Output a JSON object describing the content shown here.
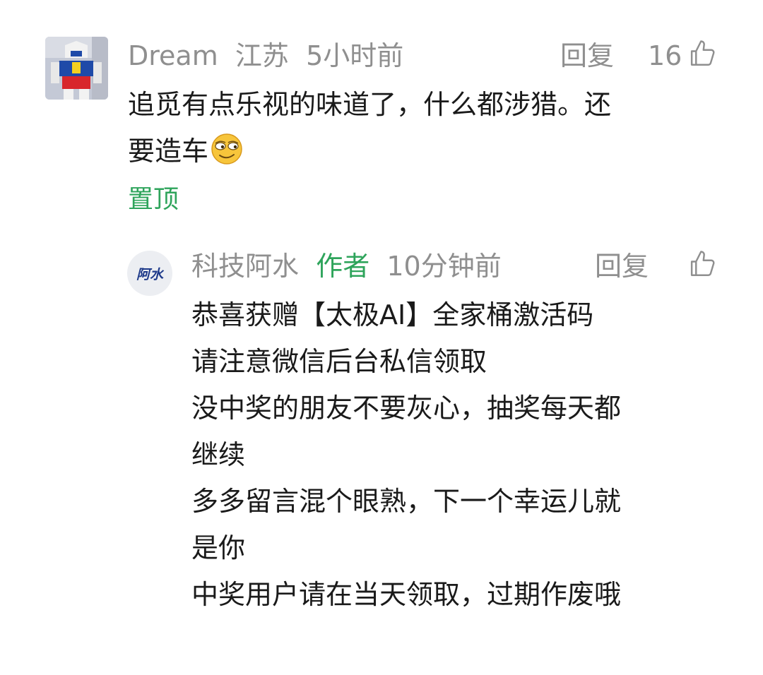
{
  "comment": {
    "user": "Dream",
    "location": "江苏",
    "time": "5小时前",
    "reply_label": "回复",
    "like_count": "16",
    "text_line1": "追觅有点乐视的味道了，什么都涉猎。还",
    "text_line2": "要造车",
    "pinned_label": "置顶",
    "avatar_icon": "gundam-avatar"
  },
  "reply": {
    "user": "科技阿水",
    "author_tag": "作者",
    "time": "10分钟前",
    "reply_label": "回复",
    "avatar_text": "阿水",
    "lines": [
      "恭喜获赠【太极AI】全家桶激活码",
      "请注意微信后台私信领取",
      "没中奖的朋友不要灰心，抽奖每天都",
      "继续",
      "多多留言混个眼熟，下一个幸运儿就",
      "是你",
      "中奖用户请在当天领取，过期作废哦"
    ]
  },
  "icons": {
    "like": "thumbs-up-icon",
    "emoji": "smirk-emoji-icon"
  },
  "colors": {
    "accent_green": "#2ea45b",
    "meta_gray": "#8f8f8f",
    "text": "#1a1a1a"
  }
}
